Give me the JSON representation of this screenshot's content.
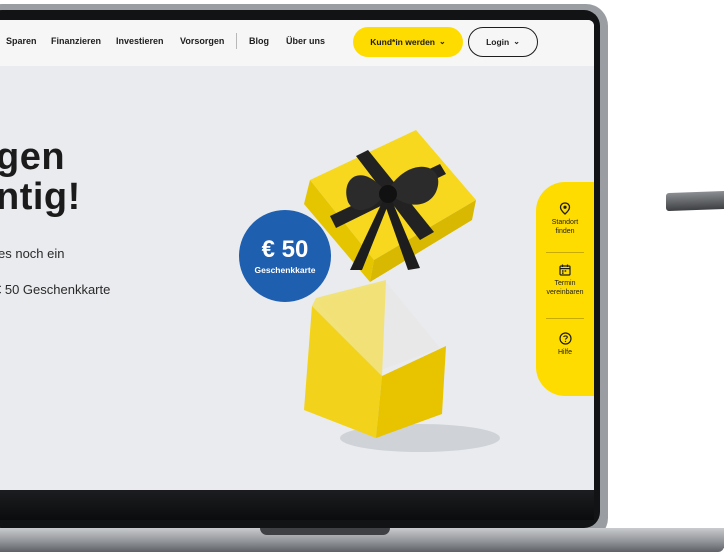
{
  "nav": {
    "links": [
      "Sparen",
      "Finanzieren",
      "Investieren",
      "Vorsorgen",
      "Blog",
      "Über uns"
    ],
    "primary_button": "Kund*in werden",
    "login_button": "Login"
  },
  "hero": {
    "headline_line1": "gen",
    "headline_line2": "ntig!",
    "subtext_line1": "es noch ein",
    "subtext_line2": "€ 50 Geschenkkarte"
  },
  "badge": {
    "amount": "€ 50",
    "label": "Geschenkkarte"
  },
  "service_bar": {
    "items": [
      {
        "label_line1": "Standort",
        "label_line2": "finden",
        "icon": "location-pin-icon"
      },
      {
        "label_line1": "Termin",
        "label_line2": "vereinbaren",
        "icon": "calendar-icon"
      },
      {
        "label_line1": "Hilfe",
        "label_line2": "",
        "icon": "help-icon"
      }
    ]
  },
  "colors": {
    "brand_yellow": "#ffdc00",
    "badge_blue": "#1f5fb0",
    "screen_bg": "#e9ebee",
    "text_dark": "#1d1d1d"
  }
}
